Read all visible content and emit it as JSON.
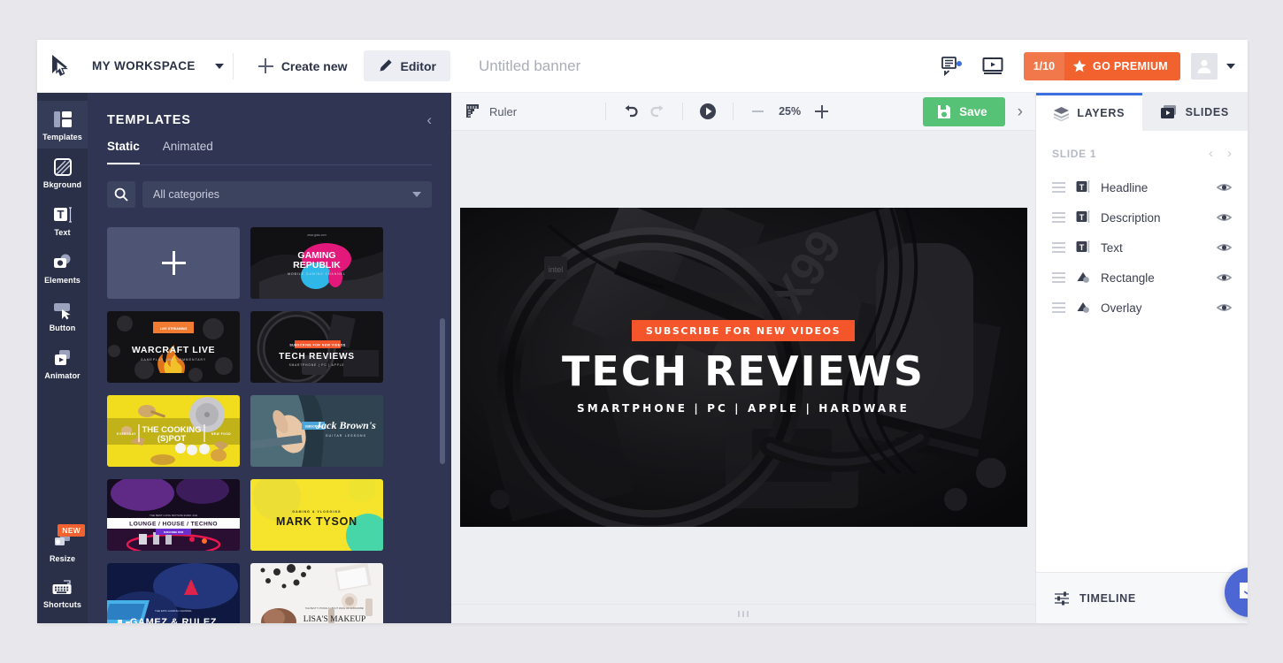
{
  "topbar": {
    "logo_icon": "cursor-logo-icon",
    "workspace": "MY WORKSPACE",
    "workspace_caret": "chevron-down-icon",
    "create_new": "Create new",
    "editor": "Editor",
    "doc_title_value": "Untitled banner",
    "doc_title_placeholder": "Untitled banner",
    "comments_icon": "comments-icon",
    "presentation_icon": "presentation-icon",
    "premium_count": "1/10",
    "premium_label": "GO PREMIUM",
    "premium_star": "star-icon",
    "premium_color": "#f2622e",
    "avatar_icon": "user-avatar-icon"
  },
  "rail": {
    "items": [
      {
        "label": "Templates",
        "icon": "templates-icon",
        "active": true,
        "badge": ""
      },
      {
        "label": "Bkground",
        "icon": "background-icon",
        "active": false,
        "badge": ""
      },
      {
        "label": "Text",
        "icon": "text-icon",
        "active": false,
        "badge": ""
      },
      {
        "label": "Elements",
        "icon": "elements-icon",
        "active": false,
        "badge": ""
      },
      {
        "label": "Button",
        "icon": "button-icon",
        "active": false,
        "badge": ""
      },
      {
        "label": "Animator",
        "icon": "animator-icon",
        "active": false,
        "badge": ""
      }
    ],
    "bottom": [
      {
        "label": "Resize",
        "icon": "resize-icon",
        "badge": "NEW"
      },
      {
        "label": "Shortcuts",
        "icon": "keyboard-icon",
        "badge": ""
      }
    ]
  },
  "panel": {
    "title": "TEMPLATES",
    "collapse_icon": "chevron-left-icon",
    "tabs": [
      {
        "label": "Static",
        "active": true
      },
      {
        "label": "Animated",
        "active": false
      }
    ],
    "search_icon": "search-icon",
    "category_value": "All categories",
    "add_new_label": "",
    "templates": [
      {
        "name": "add-new",
        "title": "",
        "subtitle": ""
      },
      {
        "name": "gaming-republik",
        "title": "GAMING REPUBLIK",
        "subtitle": "MOBILE GAMING CHANNEL"
      },
      {
        "name": "warcraft-live",
        "title": "WARCRAFT LIVE",
        "subtitle": "GAMEPLAY AND COMMENTARY"
      },
      {
        "name": "tech-reviews",
        "title": "TECH REVIEWS",
        "subtitle": "SMARTPHONE | PC | APPLE"
      },
      {
        "name": "the-cooking-spot",
        "title": "THE COOKING (S)POT",
        "subtitle": "EVERYDAY NEW FOOD"
      },
      {
        "name": "jack-browns",
        "title": "Jack Brown's",
        "subtitle": "GUITAR LESSONS"
      },
      {
        "name": "lounge-house-techno",
        "title": "LOUNGE / HOUSE / TECHNO",
        "subtitle": "THE BEST LONG MIXTAPE EVER. 24H"
      },
      {
        "name": "mark-tyson",
        "title": "MARK TYSON",
        "subtitle": "GAMING & VLOGGING"
      },
      {
        "name": "gamez-rulez",
        "title": "GAMEZ & RULEZ",
        "subtitle": "THE EPIC GAMING CHANNEL"
      },
      {
        "name": "lisas-makeup",
        "title": "LISA'S MAKEUP",
        "subtitle": "CHANNEL"
      }
    ]
  },
  "toolbar": {
    "ruler_label": "Ruler",
    "ruler_icon": "ruler-icon",
    "undo_icon": "undo-icon",
    "redo_icon": "redo-icon",
    "play_icon": "play-icon",
    "zoom_out_icon": "minus-icon",
    "zoom_level": "25%",
    "zoom_in_icon": "plus-icon",
    "save_label": "Save",
    "save_icon": "floppy-disk-icon",
    "save_color": "#56c276",
    "next_icon": "chevron-right-icon"
  },
  "canvas": {
    "badge_text": "SUBSCRIBE FOR NEW VIDEOS",
    "badge_color": "#f5552b",
    "headline": "TECH REVIEWS",
    "description": "SMARTPHONE  |  PC  |  APPLE  |  HARDWARE",
    "drag_handle": "canvas-resize-handle"
  },
  "right": {
    "tabs": [
      {
        "label": "LAYERS",
        "icon": "layers-icon",
        "active": true
      },
      {
        "label": "SLIDES",
        "icon": "slides-icon",
        "active": false
      }
    ],
    "slide_label": "SLIDE 1",
    "prev_icon": "chevron-left-icon",
    "next_icon": "chevron-right-icon",
    "layers": [
      {
        "name": "Headline",
        "type_icon": "text-layer-icon",
        "visible_icon": "eye-icon"
      },
      {
        "name": "Description",
        "type_icon": "text-layer-icon",
        "visible_icon": "eye-icon"
      },
      {
        "name": "Text",
        "type_icon": "text-layer-icon",
        "visible_icon": "eye-icon"
      },
      {
        "name": "Rectangle",
        "type_icon": "shape-layer-icon",
        "visible_icon": "eye-icon"
      },
      {
        "name": "Overlay",
        "type_icon": "shape-layer-icon",
        "visible_icon": "eye-icon"
      }
    ],
    "timeline_label": "TIMELINE",
    "timeline_icon": "timeline-icon",
    "chat_icon": "intercom-chat-icon",
    "chat_color": "#4c66d4"
  }
}
